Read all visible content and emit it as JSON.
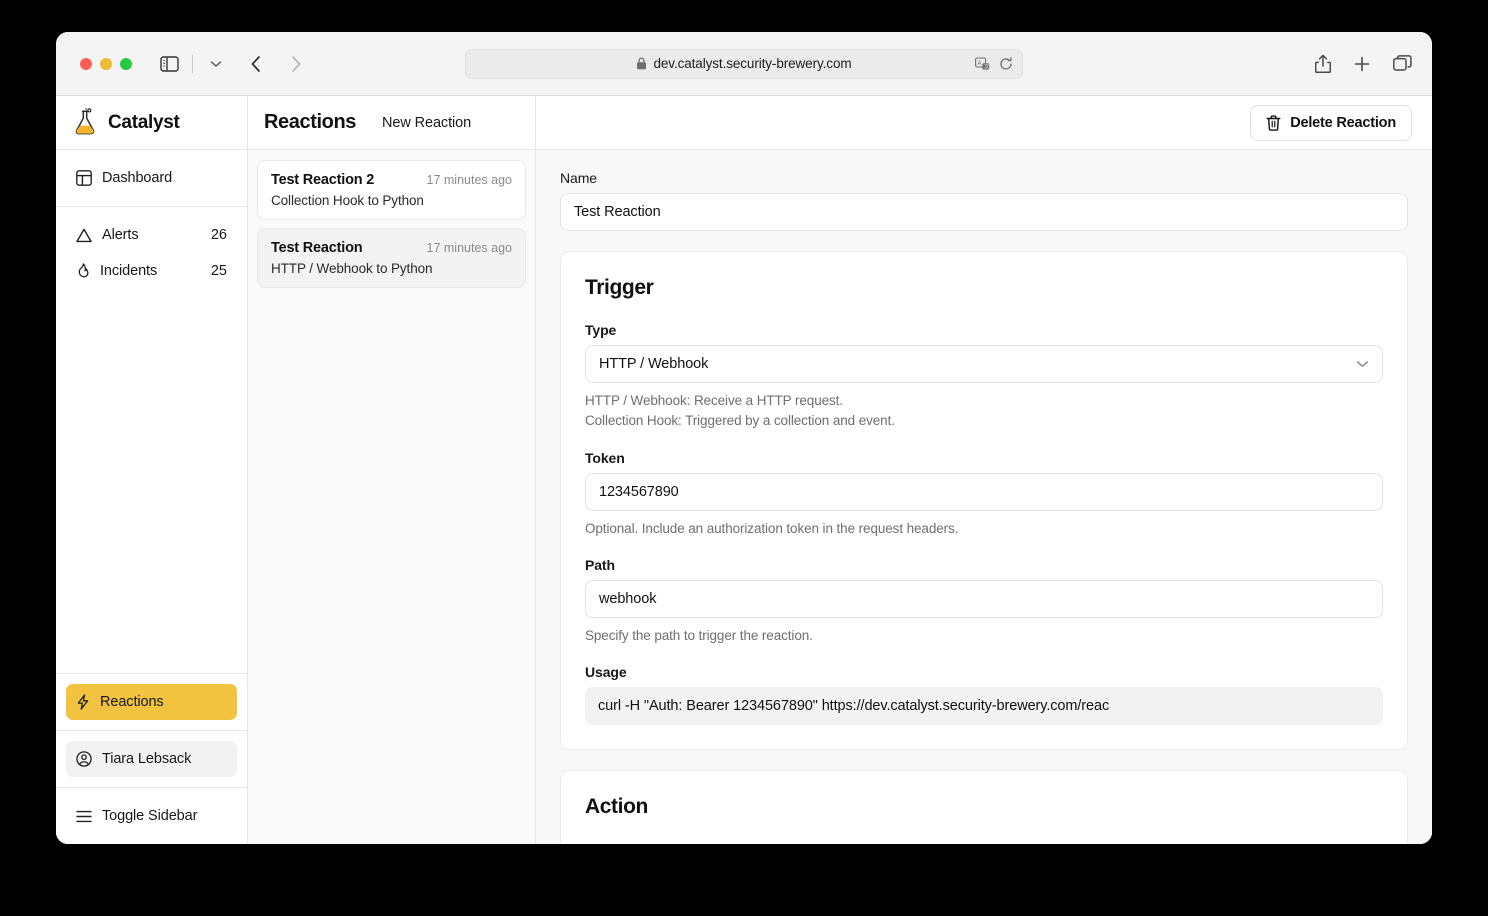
{
  "browser": {
    "url": "dev.catalyst.security-brewery.com",
    "icons": {
      "lock": "lock-icon",
      "translate": "translate-icon",
      "reload": "reload-icon",
      "share": "share-icon",
      "new_tab": "plus-icon",
      "tab_overview": "tab-overview-icon",
      "sidebar_toggle": "sidebar-toggle-icon",
      "chevron_down": "chevron-down-icon",
      "back": "back-arrow-icon",
      "forward": "forward-arrow-icon"
    }
  },
  "sidebar": {
    "brand": "Catalyst",
    "primary": [
      {
        "label": "Dashboard",
        "icon": "dashboard-icon",
        "count": ""
      }
    ],
    "items": [
      {
        "label": "Alerts",
        "icon": "alert-triangle-icon",
        "count": "26"
      },
      {
        "label": "Incidents",
        "icon": "flame-icon",
        "count": "25"
      }
    ],
    "bottom": [
      {
        "label": "Reactions",
        "icon": "lightning-icon",
        "state": "active"
      },
      {
        "label": "Tiara Lebsack",
        "icon": "user-circle-icon",
        "state": "soft"
      },
      {
        "label": "Toggle Sidebar",
        "icon": "hamburger-icon",
        "state": "plain"
      }
    ]
  },
  "list_panel": {
    "title": "Reactions",
    "new_button": "New Reaction",
    "reactions": [
      {
        "name": "Test Reaction 2",
        "time": "17 minutes ago",
        "subtitle": "Collection Hook to Python",
        "selected": false
      },
      {
        "name": "Test Reaction",
        "time": "17 minutes ago",
        "subtitle": "HTTP / Webhook to Python",
        "selected": true
      }
    ]
  },
  "main": {
    "delete_button": "Delete Reaction",
    "name_label": "Name",
    "name_value": "Test Reaction",
    "trigger": {
      "title": "Trigger",
      "type_label": "Type",
      "type_value": "HTTP / Webhook",
      "type_hint_line1": "HTTP / Webhook: Receive a HTTP request.",
      "type_hint_line2": "Collection Hook: Triggered by a collection and event.",
      "token_label": "Token",
      "token_value": "1234567890",
      "token_hint": "Optional. Include an authorization token in the request headers.",
      "path_label": "Path",
      "path_value": "webhook",
      "path_hint": "Specify the path to trigger the reaction.",
      "usage_label": "Usage",
      "usage_value": "curl -H \"Auth: Bearer 1234567890\" https://dev.catalyst.security-brewery.com/reac"
    },
    "action": {
      "title": "Action"
    }
  },
  "colors": {
    "accent": "#f2c340",
    "page_bg": "#f8f8f8",
    "list_bg": "#fafafa"
  }
}
